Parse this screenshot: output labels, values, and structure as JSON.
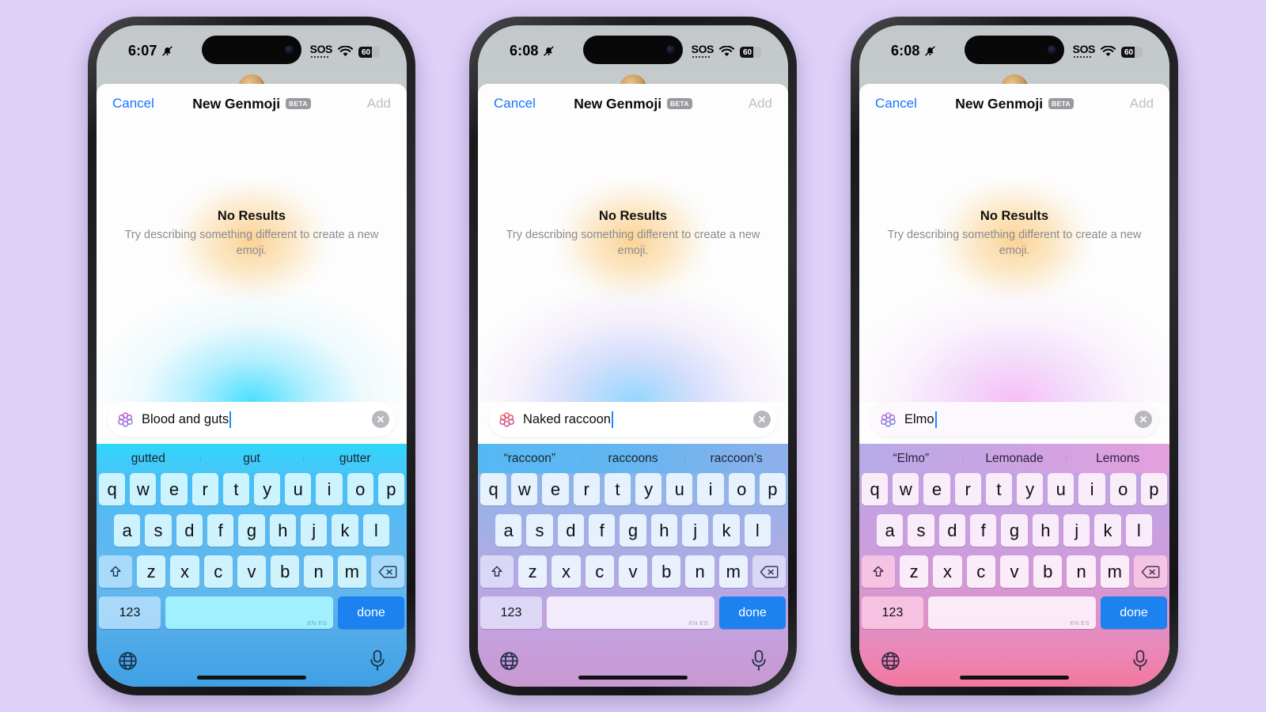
{
  "background_color": "#ded0f7",
  "status_bar": {
    "silent_icon": "bell-slash-icon",
    "sos_label": "SOS",
    "wifi_icon": "wifi-icon",
    "battery_level": "60"
  },
  "nav": {
    "cancel_label": "Cancel",
    "title": "New Genmoji",
    "beta_label": "BETA",
    "add_label": "Add"
  },
  "empty_state": {
    "title": "No Results",
    "subtitle": "Try describing something different to create a new emoji."
  },
  "keyboard": {
    "row1": [
      "q",
      "w",
      "e",
      "r",
      "t",
      "y",
      "u",
      "i",
      "o",
      "p"
    ],
    "row2": [
      "a",
      "s",
      "d",
      "f",
      "g",
      "h",
      "j",
      "k",
      "l"
    ],
    "row3": [
      "z",
      "x",
      "c",
      "v",
      "b",
      "n",
      "m"
    ],
    "shift_icon": "shift-icon",
    "backspace_icon": "backspace-icon",
    "numbers_label": "123",
    "space_label": "",
    "space_languages": "EN ES",
    "done_label": "done",
    "globe_icon": "globe-icon",
    "mic_icon": "microphone-icon"
  },
  "phones": [
    {
      "id": "phone-1",
      "time": "6:07",
      "input_value": "Blood and guts",
      "clear_icon": "clear-x-icon",
      "ai_icon": "apple-intelligence-icon",
      "suggestions": [
        "gutted",
        "gut",
        "gutter"
      ],
      "theme_color": "#3fc2f7"
    },
    {
      "id": "phone-2",
      "time": "6:08",
      "input_value": "Naked raccoon",
      "clear_icon": "clear-x-icon",
      "ai_icon": "apple-intelligence-icon",
      "suggestions": [
        "“raccoon”",
        "raccoons",
        "raccoon’s"
      ],
      "theme_color": "#a6aee6"
    },
    {
      "id": "phone-3",
      "time": "6:08",
      "input_value": "Elmo",
      "clear_icon": "clear-x-icon",
      "ai_icon": "apple-intelligence-icon",
      "suggestions": [
        "“Elmo”",
        "Lemonade",
        "Lemons"
      ],
      "theme_color": "#dd93ca"
    }
  ]
}
